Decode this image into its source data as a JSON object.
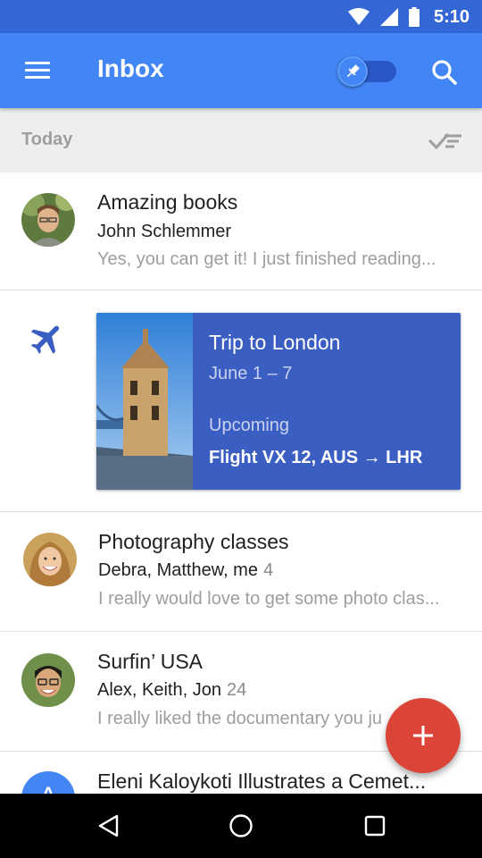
{
  "status_bar": {
    "time": "5:10",
    "icons": [
      "wifi-icon",
      "signal-icon",
      "battery-icon"
    ]
  },
  "app_bar": {
    "title": "Inbox",
    "color": "#4285f4",
    "menu_icon": "menu-icon",
    "pin_icon": "pin-icon",
    "search_icon": "search-icon"
  },
  "section": {
    "title": "Today",
    "sweep_icon": "sweep-done-icon"
  },
  "emails": [
    {
      "title": "Amazing books",
      "sender": "John Schlemmer",
      "count": "",
      "snippet": "Yes, you can get it! I just finished reading..."
    },
    {
      "title": "Photography classes",
      "sender": "Debra, Matthew, me",
      "count": "4",
      "snippet": "I really would love to get some photo clas..."
    },
    {
      "title": "Surfin’ USA",
      "sender": "Alex, Keith, Jon",
      "count": "24",
      "snippet": "I really liked the documentary you ju"
    },
    {
      "title": "Eleni Kaloykoti Illustrates a Cemet...",
      "avatar_letter": "A"
    }
  ],
  "trip": {
    "icon": "airplane-icon",
    "title": "Trip to London",
    "dates": "June 1 – 7",
    "status": "Upcoming",
    "flight": "Flight VX 12,  AUS → LHR",
    "card_color": "#3b5ec2"
  },
  "fab": {
    "icon": "plus-icon",
    "color": "#db4437"
  },
  "nav_bar": {
    "icons": [
      "back-icon",
      "home-icon",
      "recents-icon"
    ]
  }
}
